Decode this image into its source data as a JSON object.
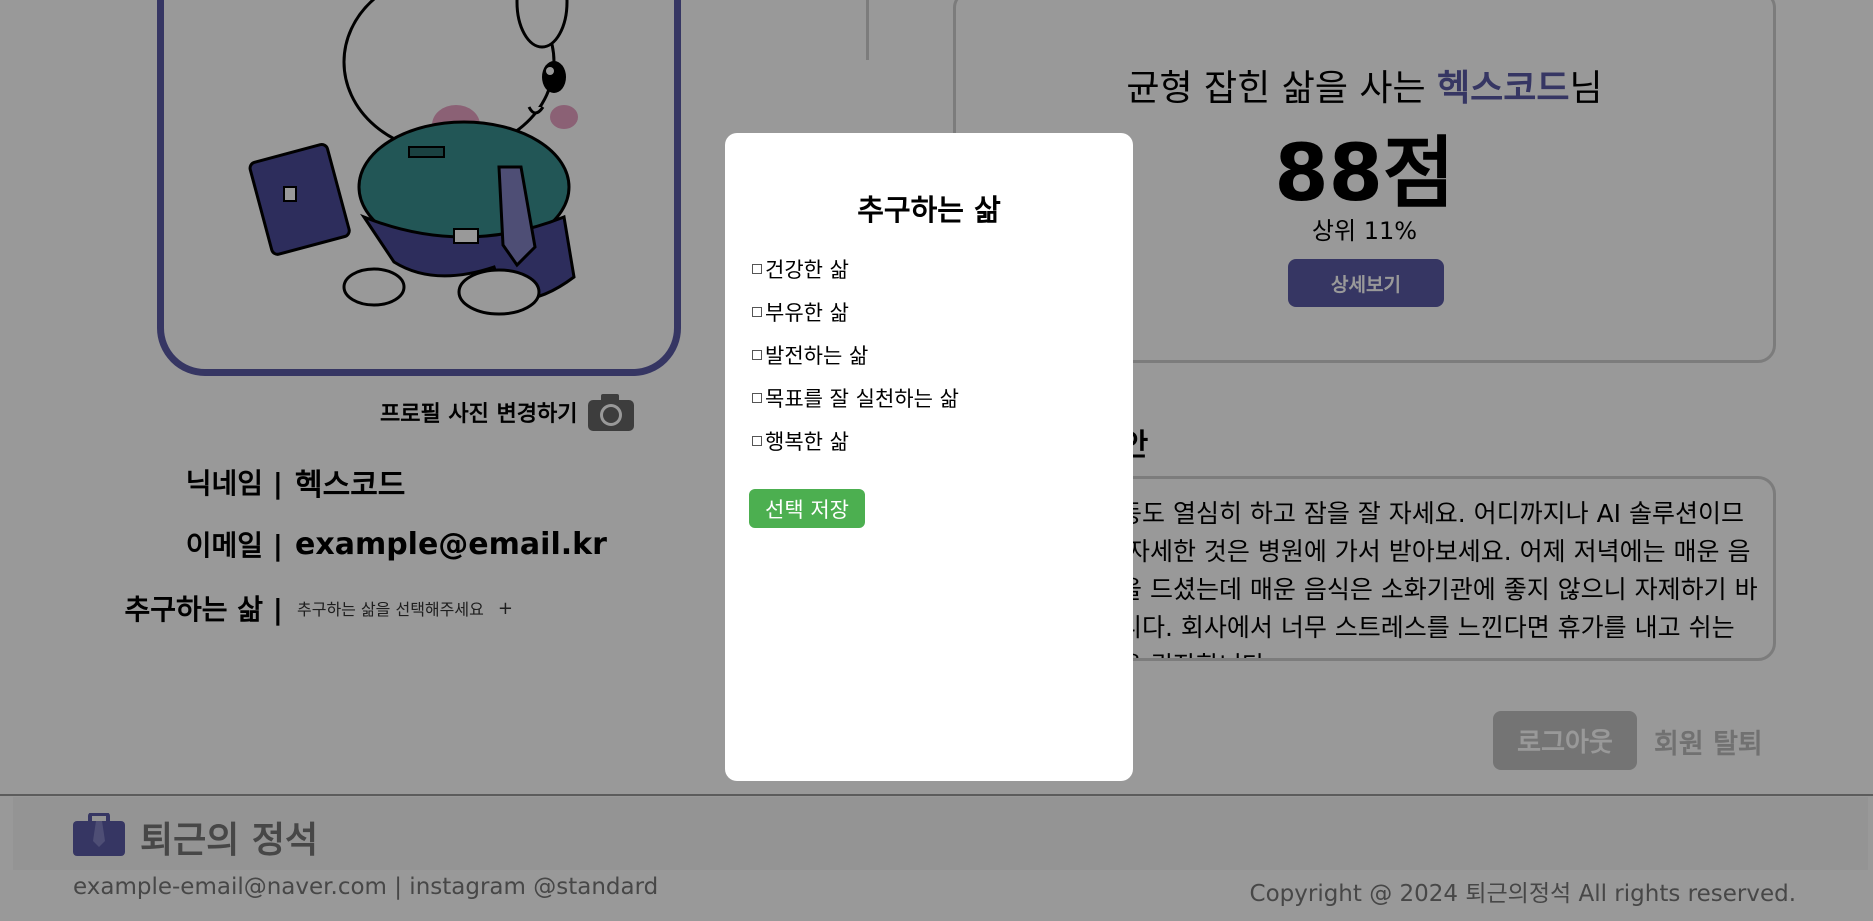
{
  "profile": {
    "change_photo_label": "프로필 사진 변경하기",
    "nickname_label": "닉네임 |",
    "nickname_value": "헥스코드",
    "email_label": "이메일 |",
    "email_value": "example@email.kr",
    "life_label": "추구하는 삶 |",
    "life_hint": "추구하는 삶을 선택해주세요",
    "life_add": "+"
  },
  "score_card": {
    "title_prefix": "균형 잡힌 삶을 사는 ",
    "title_name": "헥스코드",
    "title_suffix": "님",
    "score": "88점",
    "rank": "상위 11%",
    "detail_button": "상세보기"
  },
  "advice": {
    "heading": "제안",
    "text": "운동도 열심히 하고 잠을 잘 자세요. 어디까지나 AI 솔루션이므로 자세한 것은 병원에 가서 받아보세요. 어제 저녁에는 매운 음식을 드셨는데 매운 음식은 소화기관에 좋지 않으니 자제하기 바랍니다. 회사에서 너무 스트레스를 느낀다면 휴가를 내고 쉬는 것을 권장합니다."
  },
  "account": {
    "logout": "로그아웃",
    "withdraw": "회원 탈퇴"
  },
  "footer": {
    "logo_text": "퇴근의 정석",
    "contact": "example-email@naver.com | instagram @standard",
    "copyright": "Copyright @ 2024 퇴근의정석 All rights reserved."
  },
  "modal": {
    "title": "추구하는 삶",
    "options": [
      "건강한 삶",
      "부유한 삶",
      "발전하는 삶",
      "목표를 잘 실천하는 삶",
      "행복한 삶"
    ],
    "save_button": "선택 저장"
  },
  "colors": {
    "accent": "#5b5ba6",
    "save_green": "#4caf50",
    "overlay": "rgba(0,0,0,0.4)"
  }
}
